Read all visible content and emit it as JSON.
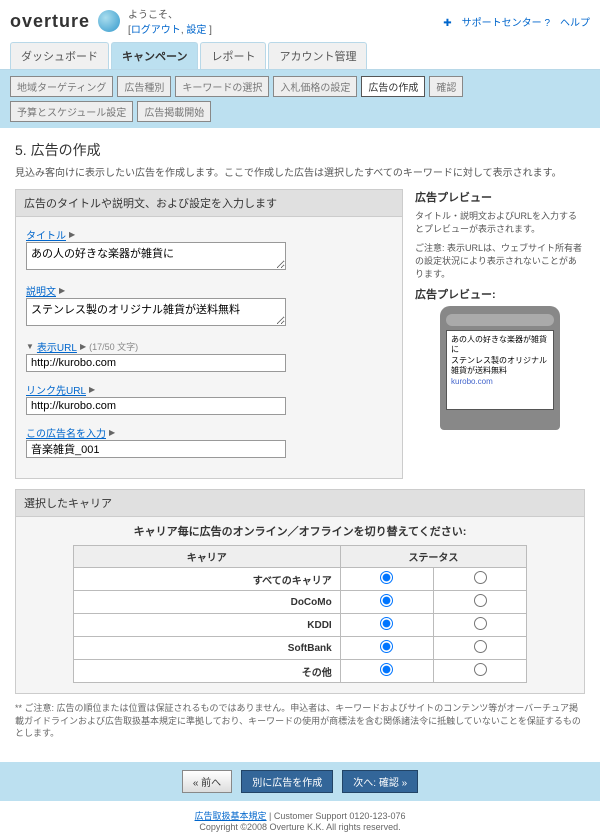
{
  "header": {
    "logo": "overture",
    "welcome_prefix": "ようこそ、",
    "logout_link": "ログアウト",
    "settings_link": "設定",
    "support_link": "サポートセンター",
    "help_link": "ヘルプ"
  },
  "main_tabs": [
    "ダッシュボード",
    "キャンペーン",
    "レポート",
    "アカウント管理"
  ],
  "sub_tabs": [
    "地域ターゲティング",
    "広告種別",
    "キーワードの選択",
    "入札価格の設定",
    "広告の作成",
    "確認",
    "予算とスケジュール設定",
    "広告掲載開始"
  ],
  "page": {
    "title": "5. 広告の作成",
    "desc": "見込み客向けに表示したい広告を作成します。ここで作成した広告は選択したすべてのキーワードに対して表示されます。"
  },
  "form": {
    "panel_head": "広告のタイトルや説明文、および設定を入力します",
    "title_label": "タイトル",
    "title_value": "あの人の好きな楽器が雑貨に",
    "desc_label": "説明文",
    "desc_value": "ステンレス製のオリジナル雑貨が送料無料",
    "display_url_label": "表示URL",
    "display_url_value": "http://kurobo.com",
    "display_url_count": "(17/50 文字)",
    "link_url_label": "リンク先URL",
    "link_url_value": "http://kurobo.com",
    "ad_name_label": "この広告名を入力",
    "ad_name_value": "音楽雑貨_001",
    "selected_carrier_label": "選択したキャリア"
  },
  "preview": {
    "head": "広告プレビュー",
    "desc1": "タイトル・説明文およびURLを入力するとプレビューが表示されます。",
    "desc2": "ご注意: 表示URLは、ウェブサイト所有者の設定状況により表示されないことがあります。",
    "head2": "広告プレビュー:",
    "ad_title": "あの人の好きな楽器が雑貨に",
    "ad_desc": "ステンレス製のオリジナル雑貨が送料無料",
    "ad_url": "kurobo.com"
  },
  "carrier": {
    "title": "キャリア毎に広告のオンライン／オフラインを切り替えてください:",
    "col_carrier": "キャリア",
    "col_status": "ステータス",
    "rows": [
      "すべてのキャリア",
      "DoCoMo",
      "KDDI",
      "SoftBank",
      "その他"
    ]
  },
  "footnote": "** ご注意: 広告の順位または位置は保証されるものではありません。申込者は、キーワードおよびサイトのコンテンツ等がオーバーチュア掲載ガイドラインおよび広告取扱基本規定に準拠しており、キーワードの使用が商標法を含む関係諸法令に抵触していないことを保証するものとします。",
  "buttons": {
    "prev": "« 前へ",
    "another": "別に広告を作成",
    "next": "次へ: 確認 »"
  },
  "footer": {
    "link": "広告取扱基本規定",
    "support": " | Customer Support 0120-123-076",
    "copyright": "Copyright ©2008 Overture K.K. All rights reserved."
  }
}
